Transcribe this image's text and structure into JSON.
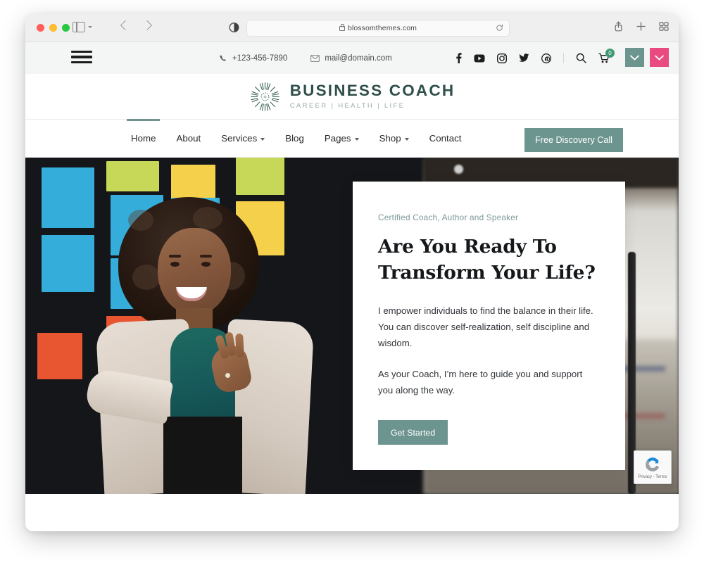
{
  "browser": {
    "url": "blossomthemes.com",
    "lock_icon": "lock-icon",
    "reload_icon": "reload-icon",
    "share_icon": "share-icon",
    "new_tab_icon": "plus-icon",
    "tabs_icon": "tab-overview-icon",
    "sidebar_icon": "sidebar-toggle-icon",
    "back_icon": "back-arrow-icon",
    "forward_icon": "forward-arrow-icon",
    "reader_icon": "reader-mode-icon"
  },
  "topbar": {
    "menu_icon": "hamburger-menu-icon",
    "phone": "+123-456-7890",
    "email": "mail@domain.com",
    "social": [
      {
        "name": "facebook-icon",
        "label": "Facebook"
      },
      {
        "name": "youtube-icon",
        "label": "YouTube"
      },
      {
        "name": "instagram-icon",
        "label": "Instagram"
      },
      {
        "name": "twitter-icon",
        "label": "Twitter"
      },
      {
        "name": "pinterest-icon",
        "label": "Pinterest"
      }
    ],
    "search_icon": "search-icon",
    "cart_icon": "cart-icon",
    "cart_count": "0",
    "teal_button_icon": "chevron-down-icon",
    "pink_button_icon": "chevron-down-icon"
  },
  "logo": {
    "mark": "dandelion-burst-icon",
    "title": "BUSINESS COACH",
    "tagline": "CAREER | HEALTH | LIFE"
  },
  "nav": {
    "items": [
      {
        "label": "Home",
        "has_caret": false,
        "active": true
      },
      {
        "label": "About",
        "has_caret": false,
        "active": false
      },
      {
        "label": "Services",
        "has_caret": true,
        "active": false
      },
      {
        "label": "Blog",
        "has_caret": false,
        "active": false
      },
      {
        "label": "Pages",
        "has_caret": true,
        "active": false
      },
      {
        "label": "Shop",
        "has_caret": true,
        "active": false
      },
      {
        "label": "Contact",
        "has_caret": false,
        "active": false
      }
    ],
    "cta_label": "Free Discovery Call"
  },
  "hero": {
    "eyebrow": "Certified Coach, Author and Speaker",
    "heading_line1": "Are You Ready To",
    "heading_line2": "Transform Your Life?",
    "paragraph1": "I empower individuals to find the balance in their life. You can discover self-realization, self discipline and wisdom.",
    "paragraph2": "As your Coach, I’m here to guide you and support you along the way.",
    "button_label": "Get Started",
    "image_alt": "Smiling woman in beige blazer in front of a board covered with colorful sticky notes"
  },
  "recaptcha": {
    "icon": "recaptcha-icon",
    "privacy": "Privacy",
    "separator": "-",
    "terms": "Terms"
  },
  "colors": {
    "accent_teal": "#6d9590",
    "accent_pink": "#e94b80",
    "logo_green": "#2f4f4a",
    "eyebrow": "#7b9896",
    "cart_badge": "#3f9a72"
  }
}
